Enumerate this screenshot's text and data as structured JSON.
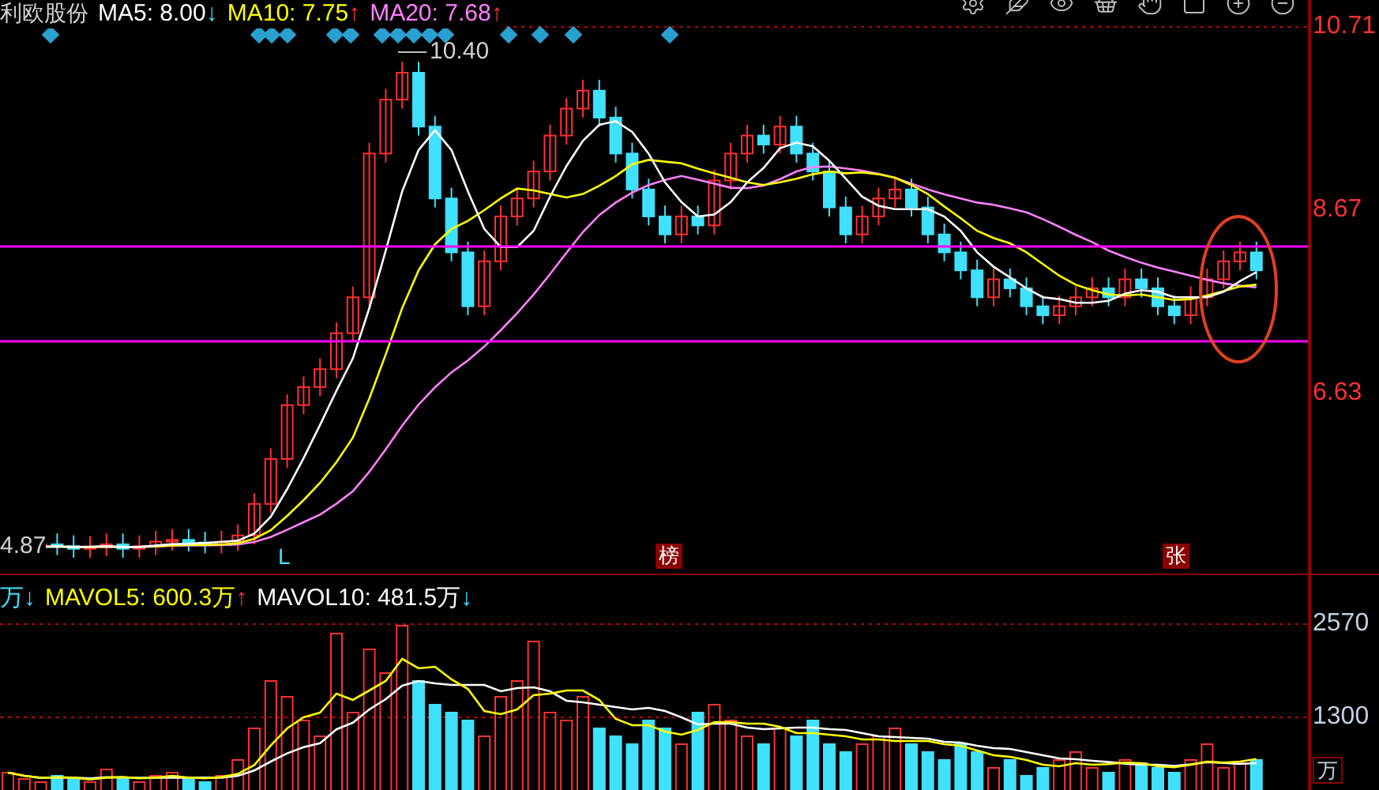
{
  "stock": {
    "name": "利欧股份",
    "indicators": [
      {
        "label": "MA5: 8.00",
        "color": "#ffffff",
        "arrow": {
          "text": "↓",
          "color": "#40e0ff"
        }
      },
      {
        "label": "MA10: 7.75",
        "color": "#ffff00",
        "arrow": {
          "text": "↑",
          "color": "#ff3030"
        }
      },
      {
        "label": "MA20: 7.68",
        "color": "#ff80ff",
        "arrow": {
          "text": "↑",
          "color": "#ff3030"
        }
      }
    ]
  },
  "price_axis": [
    "10.71",
    "8.67",
    "6.63"
  ],
  "chart_labels": {
    "high": "10.40",
    "low": "4.87",
    "marker": "L",
    "badges": [
      "榜",
      "张"
    ]
  },
  "volume": {
    "indicators": [
      {
        "label": "万",
        "color": "#40e0ff",
        "arrow": {
          "text": "↓",
          "color": "#40e0ff"
        }
      },
      {
        "label": "MAVOL5: 600.3万",
        "color": "#ffff00",
        "arrow": {
          "text": "↑",
          "color": "#ff3030"
        }
      },
      {
        "label": "MAVOL10: 481.5万",
        "color": "#ffffff",
        "arrow": {
          "text": "↓",
          "color": "#40e0ff"
        }
      }
    ],
    "axis": [
      "2570",
      "1300"
    ],
    "unit": "万"
  }
}
